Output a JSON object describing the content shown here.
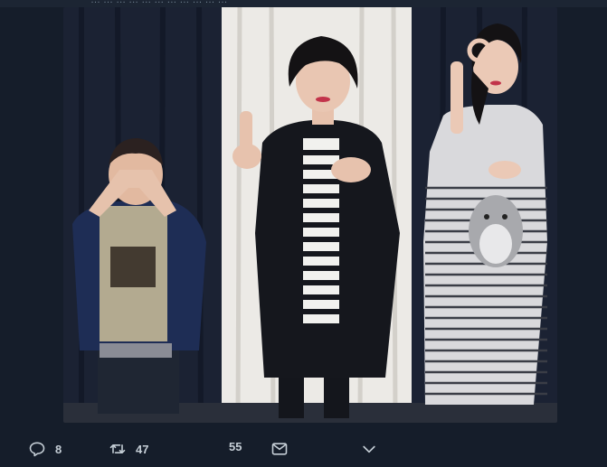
{
  "header": {
    "cut_text": "…  …  …  …  …  …  …  …  …  …  …"
  },
  "photo": {
    "description_icon": "group-photo"
  },
  "actions": {
    "reply_count": "8",
    "retweet_count": "47",
    "like_count": "55"
  },
  "colors": {
    "background": "#151d2a",
    "icon": "#c5ced6",
    "curtain_dark": "#1b2233",
    "curtain_white": "#eceae6"
  },
  "icons": [
    "reply-icon",
    "retweet-icon",
    "direct-message-icon",
    "chevron-down-icon"
  ]
}
